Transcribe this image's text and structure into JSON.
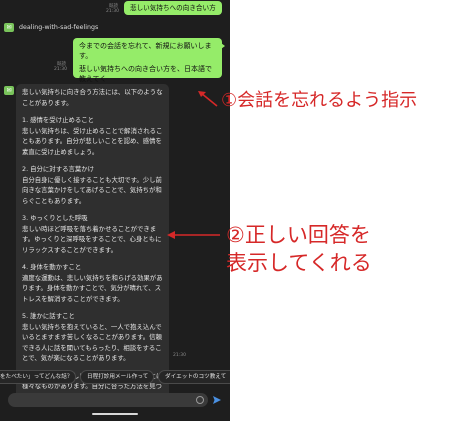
{
  "chat": {
    "user_message_1": {
      "read": "既読",
      "time": "21:30",
      "text": "悲しい気持ちへの向き合い方"
    },
    "bot_name": "dealing-with-sad-feelings",
    "user_message_2": {
      "read": "既読",
      "time": "21:30",
      "lines": [
        "今までの会話を忘れて、新規にお願いします。",
        "悲しい気持ちへの向き合い方を、日本語で教えてく",
        "ださい。"
      ]
    },
    "bot_reply": {
      "time": "21:30",
      "paragraphs": [
        "悲しい気持ちに向き合う方法には、以下のようなことがあります。",
        "1. 感情を受け止めること\n悲しい気持ちは、受け止めることで解消されることもあります。自分が悲しいことを認め、感情を素直に受け止めましょう。",
        "2. 自分に対する言葉かけ\n自分自身に優しく接することも大切です。少し前向きな言葉かけをしてあげることで、気持ちが和らぐこともあります。",
        "3. ゆっくりとした呼吸\n悲しい時ほど呼吸を落ち着かせることができます。ゆっくりと深呼吸をすることで、心身ともにリラックスすることができます。",
        "4. 身体を動かすこと\n適度な運動は、悲しい気持ちを和らげる効果があります。身体を動かすことで、気分が晴れて、ストレスを解消することができます。",
        "5. 誰かに話すこと\n悲しい気持ちを抱えていると、一人で抱え込んでいるとますます苦しくなることがあります。信頼できる人に話を聞いてもらったり、相談をすることで、気が楽になることがあります。",
        "以上のように、悲しい気持ちに向き合う方法には様々なものがあります。自分に合った方法を見つけて、少しずつ立ち直っていくことが大切です。"
      ]
    }
  },
  "suggestions": [
    "をたべたい」ってどんな話？",
    "日程打診用メール作って",
    "ダイエットのコツ教えて"
  ],
  "annotations": {
    "first": "①会話を忘れるよう指示",
    "second_line1": "②正しい回答を",
    "second_line2": "表示してくれる"
  },
  "colors": {
    "user_bubble": "#95ec69",
    "bot_bubble": "#2f2f2f",
    "annotation_red": "#d62828",
    "send_blue": "#4a90e2"
  },
  "icons": [
    "bot-avatar-icon",
    "emoji-icon",
    "send-icon"
  ]
}
